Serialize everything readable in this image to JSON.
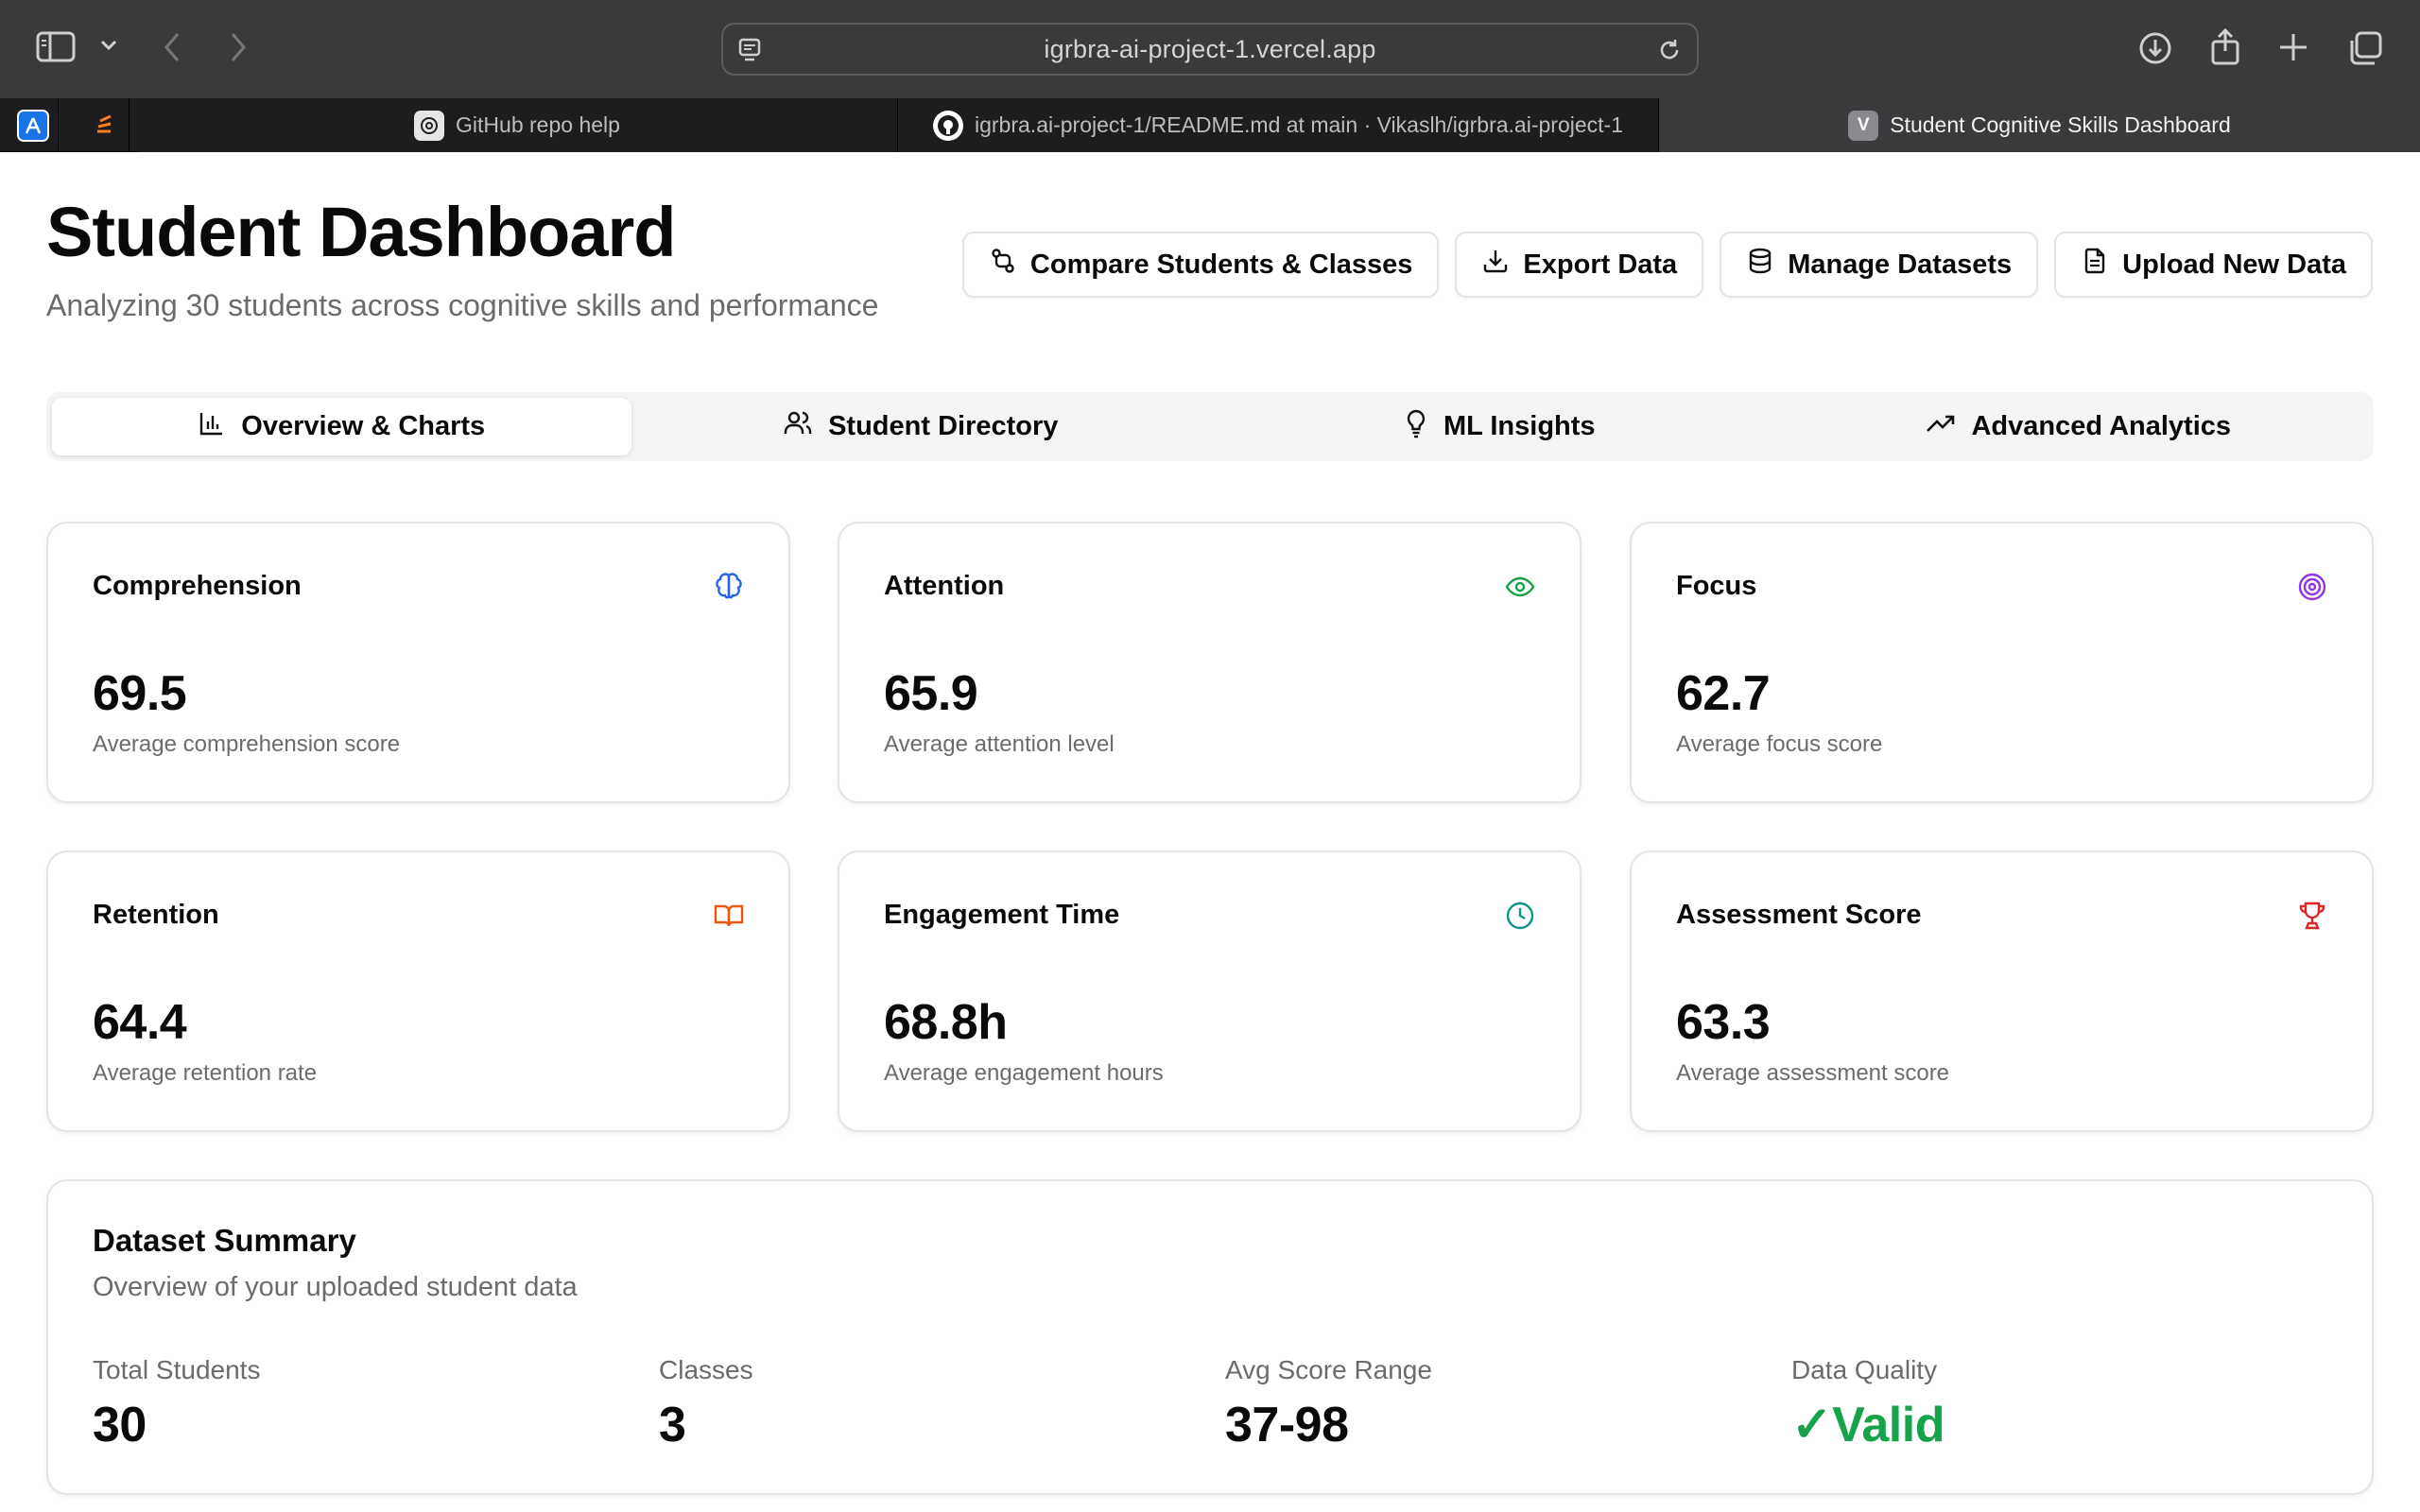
{
  "browser": {
    "url": "igrbra-ai-project-1.vercel.app",
    "tabs": [
      {
        "label": "GitHub repo help",
        "favicon": "openai-icon"
      },
      {
        "label": "igrbra.ai-project-1/README.md at main · Vikaslh/igrbra.ai-project-1",
        "favicon": "github-icon"
      },
      {
        "label": "Student Cognitive Skills Dashboard",
        "favicon": "vercel-v-icon",
        "favicon_text": "V"
      }
    ]
  },
  "header": {
    "title": "Student Dashboard",
    "subtitle": "Analyzing 30 students across cognitive skills and performance"
  },
  "actions": [
    {
      "label": "Compare Students & Classes",
      "icon": "compare-icon"
    },
    {
      "label": "Export Data",
      "icon": "download-icon"
    },
    {
      "label": "Manage Datasets",
      "icon": "database-icon"
    },
    {
      "label": "Upload New Data",
      "icon": "file-icon"
    }
  ],
  "nav_tabs": [
    {
      "label": "Overview & Charts",
      "icon": "bar-chart-icon",
      "active": true
    },
    {
      "label": "Student Directory",
      "icon": "users-icon",
      "active": false
    },
    {
      "label": "ML Insights",
      "icon": "lightbulb-icon",
      "active": false
    },
    {
      "label": "Advanced Analytics",
      "icon": "trending-up-icon",
      "active": false
    }
  ],
  "metrics": [
    {
      "title": "Comprehension",
      "value": "69.5",
      "description": "Average comprehension score",
      "icon": "brain-icon",
      "color": "#2563eb"
    },
    {
      "title": "Attention",
      "value": "65.9",
      "description": "Average attention level",
      "icon": "eye-icon",
      "color": "#16a34a"
    },
    {
      "title": "Focus",
      "value": "62.7",
      "description": "Average focus score",
      "icon": "target-icon",
      "color": "#9333ea"
    },
    {
      "title": "Retention",
      "value": "64.4",
      "description": "Average retention rate",
      "icon": "book-open-icon",
      "color": "#ea580c"
    },
    {
      "title": "Engagement Time",
      "value": "68.8h",
      "description": "Average engagement hours",
      "icon": "clock-icon",
      "color": "#0d9488"
    },
    {
      "title": "Assessment Score",
      "value": "63.3",
      "description": "Average assessment score",
      "icon": "trophy-icon",
      "color": "#dc2626"
    }
  ],
  "summary": {
    "title": "Dataset Summary",
    "subtitle": "Overview of your uploaded student data",
    "stats": [
      {
        "label": "Total Students",
        "value": "30"
      },
      {
        "label": "Classes",
        "value": "3"
      },
      {
        "label": "Avg Score Range",
        "value": "37-98"
      },
      {
        "label": "Data Quality",
        "value": "✓Valid",
        "status_color": "#16a34a"
      }
    ]
  }
}
